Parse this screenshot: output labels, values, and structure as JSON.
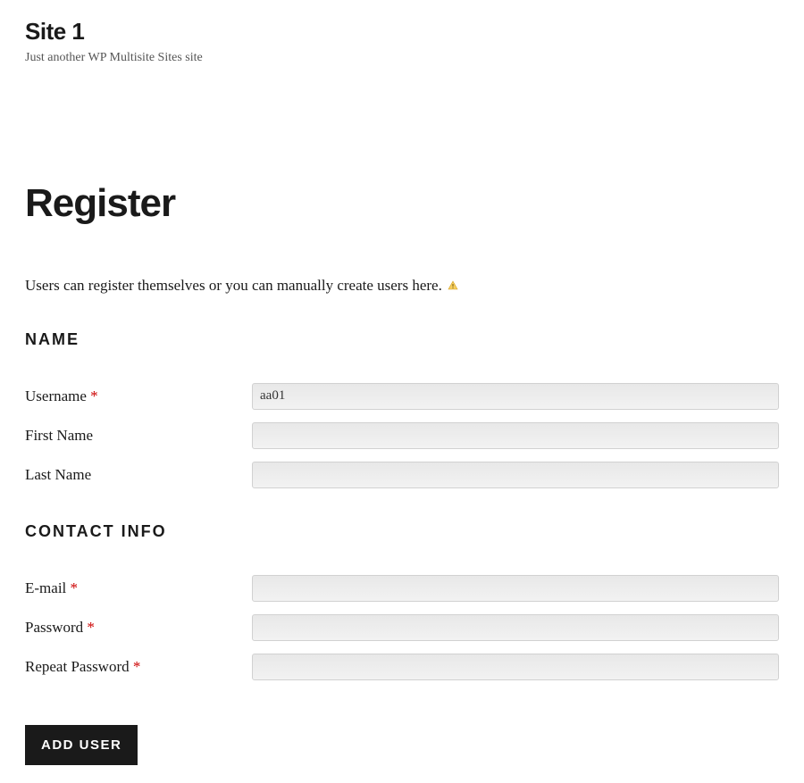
{
  "header": {
    "site_title": "Site 1",
    "site_subtitle": "Just another WP Multisite Sites site"
  },
  "page": {
    "title": "Register",
    "intro": "Users can register themselves or you can manually create users here."
  },
  "sections": {
    "name": {
      "heading": "NAME",
      "fields": {
        "username": {
          "label": "Username",
          "required": true,
          "value": "aa01"
        },
        "first_name": {
          "label": "First Name",
          "required": false,
          "value": ""
        },
        "last_name": {
          "label": "Last Name",
          "required": false,
          "value": ""
        }
      }
    },
    "contact": {
      "heading": "CONTACT INFO",
      "fields": {
        "email": {
          "label": "E-mail",
          "required": true,
          "value": ""
        },
        "password": {
          "label": "Password",
          "required": true,
          "value": ""
        },
        "repeat_password": {
          "label": "Repeat Password",
          "required": true,
          "value": ""
        }
      }
    }
  },
  "required_marker": "*",
  "submit_label": "ADD USER"
}
